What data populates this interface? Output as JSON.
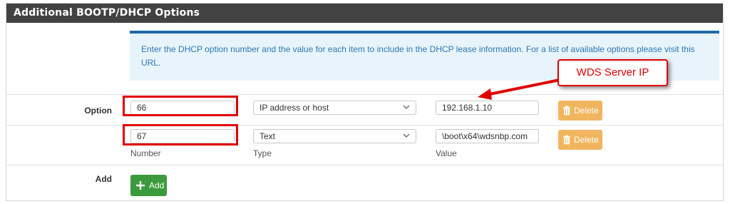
{
  "panel": {
    "title": "Additional BOOTP/DHCP Options"
  },
  "info": {
    "text": "Enter the DHCP option number and the value for each item to include in the DHCP lease information. For a list of available options please visit this",
    "link": "URL."
  },
  "option_row": {
    "label": "Option"
  },
  "options": [
    {
      "number": "66",
      "type": "IP address or host",
      "value": "192.168.1.10",
      "delete_label": "Delete"
    },
    {
      "number": "67",
      "type": "Text",
      "value": "\\boot\\x64\\wdsnbp.com",
      "delete_label": "Delete"
    }
  ],
  "sub_labels": {
    "number": "Number",
    "type": "Type",
    "value": "Value"
  },
  "add_row": {
    "label": "Add",
    "button_label": "Add"
  },
  "annotation": {
    "callout": "WDS Server IP"
  },
  "icons": {
    "delete": "trash-icon",
    "add": "plus-icon",
    "select": "chevron-down-icon"
  },
  "colors": {
    "heading_bg": "#424242",
    "info_bg": "#e8f4fb",
    "info_border": "#1e6ba8",
    "delete_btn": "#f0ad4e",
    "add_btn": "#3c9a3c",
    "annotation": "#e00000"
  }
}
